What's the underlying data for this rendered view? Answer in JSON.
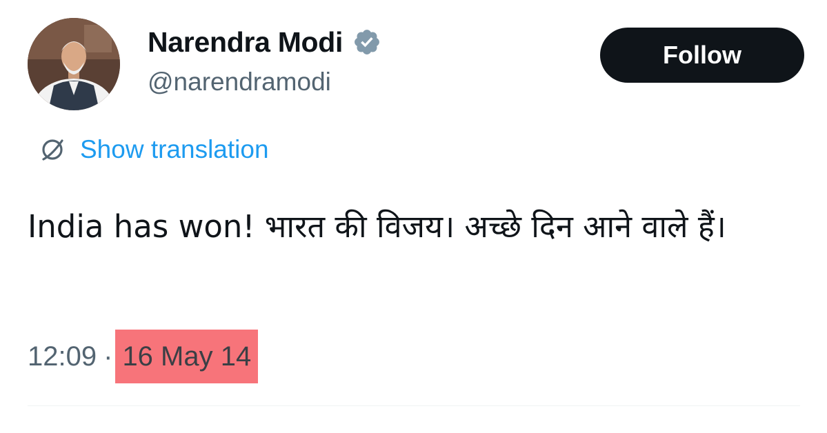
{
  "author": {
    "display_name": "Narendra Modi",
    "handle": "@narendramodi",
    "verified": true,
    "avatar_icon": "profile-photo"
  },
  "actions": {
    "follow_label": "Follow"
  },
  "translation": {
    "link_label": "Show translation",
    "icon": "globe-icon"
  },
  "tweet": {
    "text": "India has won! भारत की विजय। अच्छे दिन आने वाले हैं।",
    "time": "12:09",
    "separator": "·",
    "date": "16 May 14"
  },
  "colors": {
    "follow_bg": "#0f1419",
    "link": "#1d9bf0",
    "meta": "#536471",
    "date_highlight": "#f7747a",
    "verified_badge": "#829aab"
  }
}
